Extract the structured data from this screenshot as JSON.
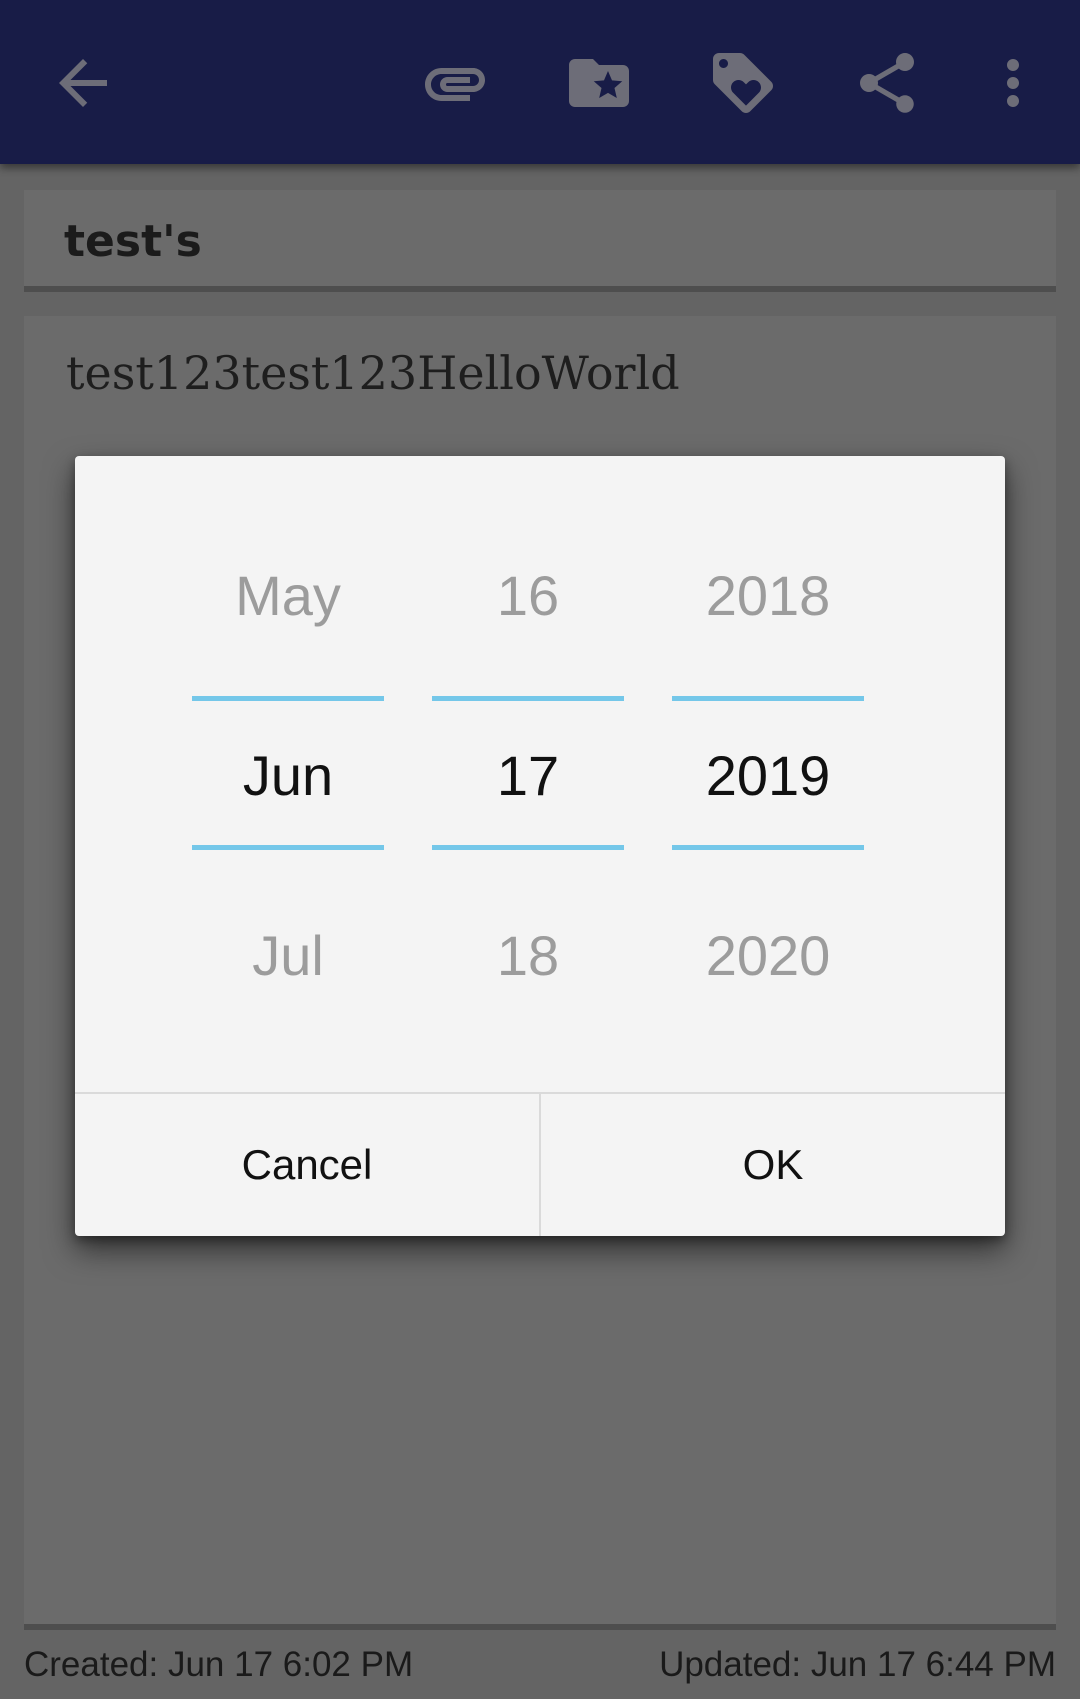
{
  "toolbar": {
    "icons": [
      "back-arrow-icon",
      "attachment-icon",
      "folder-star-icon",
      "tag-heart-icon",
      "share-icon",
      "more-vert-icon"
    ],
    "icon_color": "#6d6d78",
    "background": "#181c47"
  },
  "note": {
    "title": "test's",
    "body": "test123test123HelloWorld"
  },
  "date_picker": {
    "month": {
      "prev": "May",
      "selected": "Jun",
      "next": "Jul"
    },
    "day": {
      "prev": "16",
      "selected": "17",
      "next": "18"
    },
    "year": {
      "prev": "2018",
      "selected": "2019",
      "next": "2020"
    },
    "divider_color": "#74c7e9",
    "cancel_label": "Cancel",
    "ok_label": "OK"
  },
  "footer": {
    "created": "Created: Jun 17 6:02 PM",
    "updated": "Updated: Jun 17 6:44 PM"
  }
}
